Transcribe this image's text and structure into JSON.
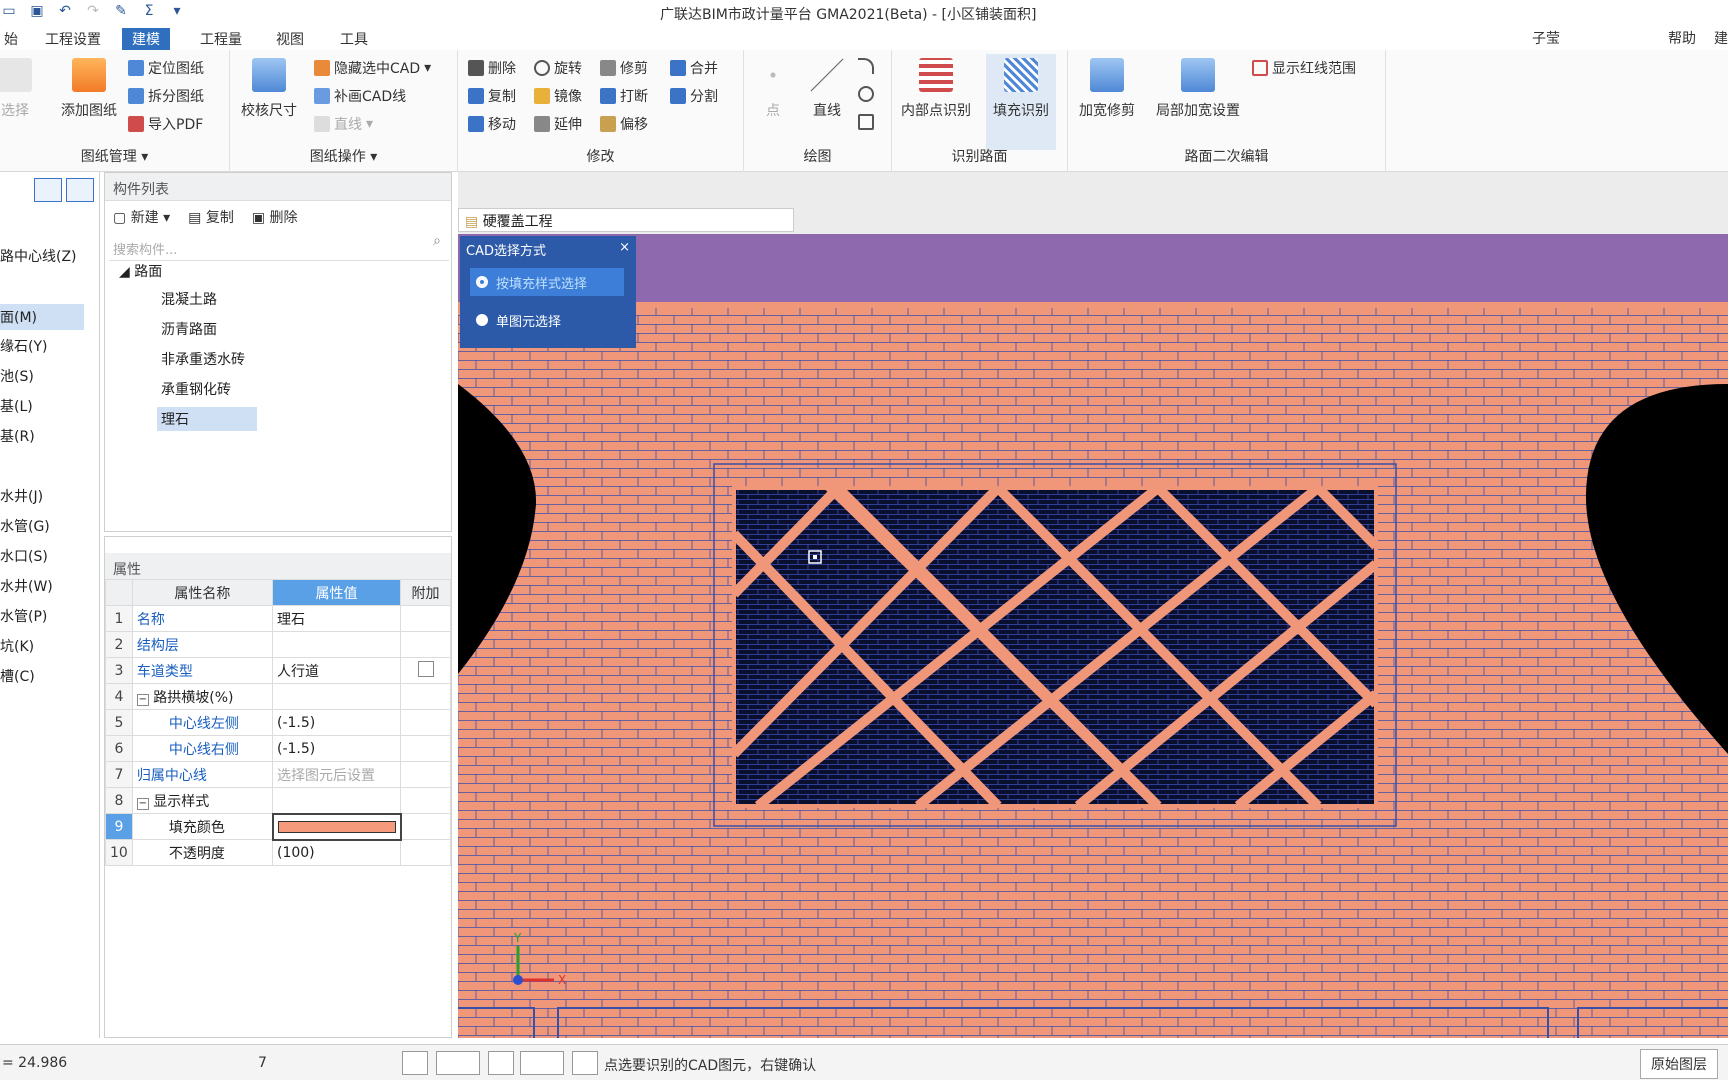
{
  "window": {
    "title": "广联达BIM市政计量平台 GMA2021(Beta) - [小区铺装面积]"
  },
  "menu": {
    "tabs": [
      "始",
      "工程设置",
      "建模",
      "工程量",
      "视图",
      "工具"
    ],
    "active": "建模",
    "right_items": [
      "子莹",
      "帮助"
    ],
    "right_trunc": "建"
  },
  "ribbon": {
    "drawing_mgmt": {
      "title": "图纸管理",
      "select_label": "选择",
      "add_drawing": "添加图纸",
      "locate": "定位图纸",
      "split": "拆分图纸",
      "import_pdf": "导入PDF"
    },
    "drawing_ops": {
      "title": "图纸操作",
      "calibrate": "校核尺寸",
      "hide_cad": "隐藏选中CAD",
      "patch_cad": "补画CAD线",
      "straight": "直线"
    },
    "modify": {
      "title": "修改",
      "delete": "删除",
      "rotate": "旋转",
      "trim": "修剪",
      "merge": "合并",
      "copy": "复制",
      "mirror": "镜像",
      "break": "打断",
      "split": "分割",
      "move": "移动",
      "extend": "延伸",
      "offset": "偏移"
    },
    "draw": {
      "title": "绘图",
      "point": "点",
      "line": "直线"
    },
    "identify": {
      "title": "识别路面",
      "inner_point": "内部点识别",
      "fill": "填充识别"
    },
    "secondary": {
      "title": "路面二次编辑",
      "widen_trim": "加宽修剪",
      "local_widen": "局部加宽设置",
      "show_redline": "显示红线范围"
    }
  },
  "leftnav": {
    "items": [
      "路中心线(Z)",
      "面(M)",
      "缘石(Y)",
      "池(S)",
      "基(L)",
      "基(R)",
      "水井(J)",
      "水管(G)",
      "水口(S)",
      "水井(W)",
      "水管(P)",
      "坑(K)",
      "槽(C)"
    ],
    "selected": "面(M)"
  },
  "component_list": {
    "header": "构件列表",
    "new": "新建",
    "copy": "复制",
    "delete": "删除",
    "search_placeholder": "搜索构件...",
    "root": "路面",
    "children": [
      "混凝土路",
      "沥青路面",
      "非承重透水砖",
      "承重钢化砖",
      "理石"
    ],
    "selected": "理石"
  },
  "properties": {
    "header": "属性",
    "col_name": "属性名称",
    "col_value": "属性值",
    "col_extra": "附加",
    "rows": [
      {
        "n": "1",
        "name": "名称",
        "value": "理石"
      },
      {
        "n": "2",
        "name": "结构层",
        "value": ""
      },
      {
        "n": "3",
        "name": "车道类型",
        "value": "人行道"
      },
      {
        "n": "4",
        "name": "路拱横坡(%)",
        "value": ""
      },
      {
        "n": "5",
        "name": "中心线左侧",
        "value": "(-1.5)"
      },
      {
        "n": "6",
        "name": "中心线右侧",
        "value": "(-1.5)"
      },
      {
        "n": "7",
        "name": "归属中心线",
        "value": "选择图元后设置"
      },
      {
        "n": "8",
        "name": "显示样式",
        "value": ""
      },
      {
        "n": "9",
        "name": "填充颜色",
        "value": ""
      },
      {
        "n": "10",
        "name": "不透明度",
        "value": "(100)"
      }
    ],
    "fill_color": "#f59a7a"
  },
  "canvas": {
    "doc_tab": "硬覆盖工程",
    "brick_color": "#f0977a",
    "header_band_color": "#8e69ad",
    "axis_x": "X",
    "axis_y": "Y"
  },
  "cad_popup": {
    "title": "CAD选择方式",
    "close": "×",
    "opt1": "按填充样式选择",
    "opt2": "单图元选择"
  },
  "status": {
    "coord": "= 24.986",
    "value": "7",
    "message": "点选要识别的CAD图元，右键确认",
    "layer_btn": "原始图层"
  }
}
